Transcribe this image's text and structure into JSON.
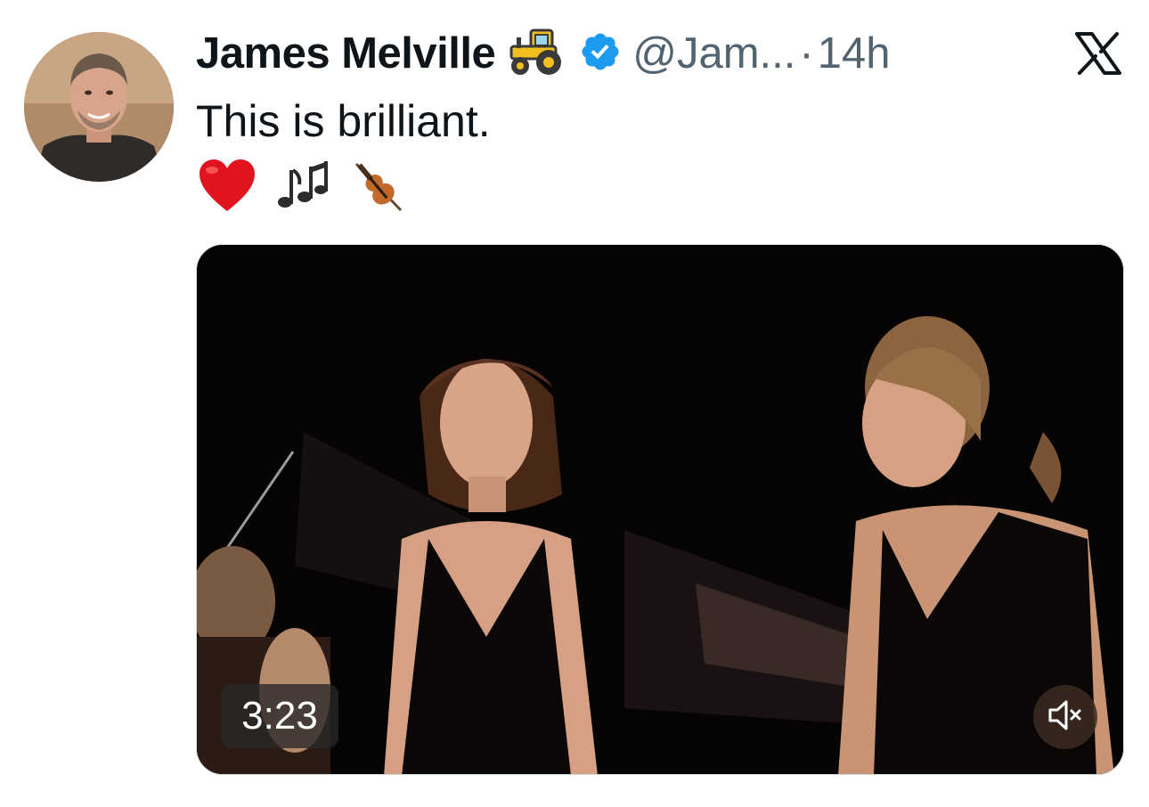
{
  "tweet": {
    "author": {
      "display_name": "James Melville",
      "handle": "@Jam...",
      "badge_icon": "tractor-emoji",
      "verified_icon": "verified-badge-icon",
      "verified_color": "#1d9bf0"
    },
    "separator": "·",
    "timestamp": "14h",
    "platform_icon": "x-logo-icon",
    "text": "This is brilliant.",
    "emojis": [
      "red-heart-emoji",
      "musical-notes-emoji",
      "violin-emoji"
    ],
    "media": {
      "type": "video",
      "duration": "3:23",
      "mute_icon": "speaker-muted-icon"
    }
  },
  "colors": {
    "primary_text": "#0f1419",
    "secondary_text": "#536471",
    "verified_blue": "#1d9bf0",
    "heart_red": "#e0141e"
  }
}
